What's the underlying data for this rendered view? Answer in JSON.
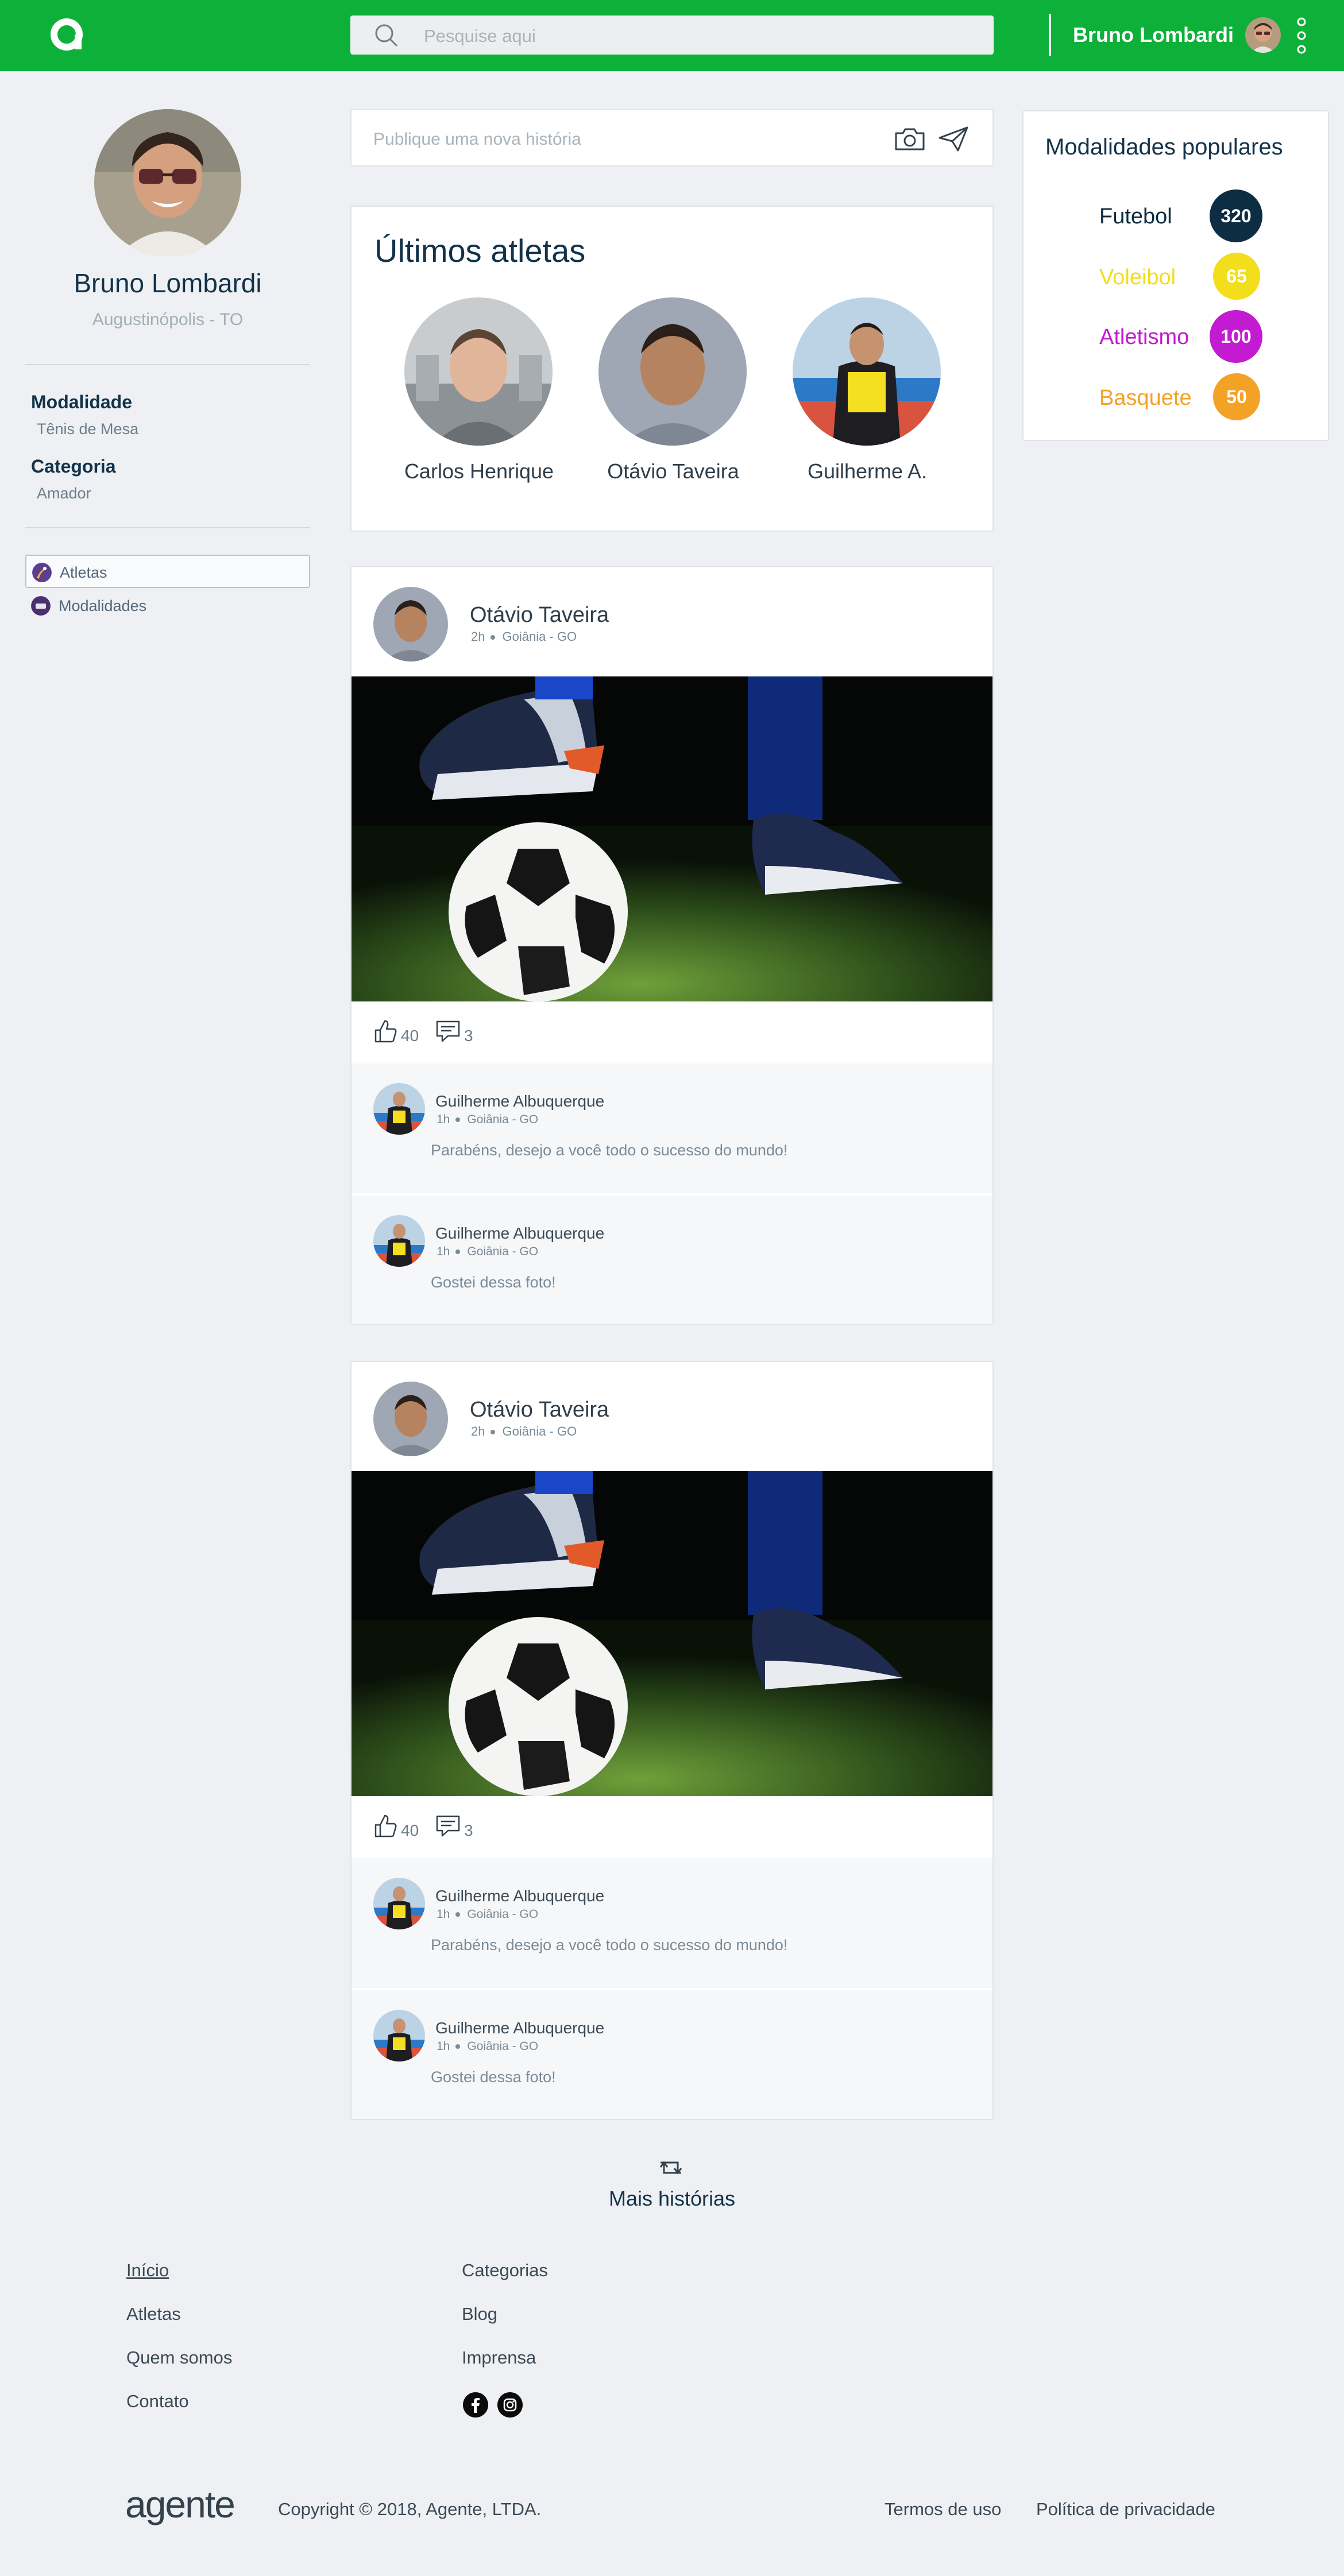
{
  "header": {
    "search_placeholder": "Pesquise aqui",
    "user_name": "Bruno Lombardi"
  },
  "profile": {
    "name": "Bruno Lombardi",
    "city": "Augustinópolis - TO",
    "modality_label": "Modalidade",
    "modality_value": "Tênis de Mesa",
    "category_label": "Categoria",
    "category_value": "Amador"
  },
  "sidebar_nav": [
    {
      "label": "Atletas",
      "active": true
    },
    {
      "label": "Modalidades",
      "active": false
    }
  ],
  "compose": {
    "placeholder": "Publique uma nova história"
  },
  "latest_athletes": {
    "title": "Últimos atletas",
    "items": [
      {
        "name": "Carlos Henrique"
      },
      {
        "name": "Otávio Taveira"
      },
      {
        "name": "Guilherme A."
      }
    ]
  },
  "posts": [
    {
      "author": "Otávio Taveira",
      "time": "2h",
      "location": "Goiânia - GO",
      "likes": "40",
      "comments_count": "3",
      "comments": [
        {
          "author": "Guilherme Albuquerque",
          "time": "1h",
          "location": "Goiânia - GO",
          "text": "Parabéns, desejo a você todo o sucesso do mundo!"
        },
        {
          "author": "Guilherme Albuquerque",
          "time": "1h",
          "location": "Goiânia - GO",
          "text": "Gostei dessa foto!"
        }
      ]
    },
    {
      "author": "Otávio Taveira",
      "time": "2h",
      "location": "Goiânia - GO",
      "likes": "40",
      "comments_count": "3",
      "comments": [
        {
          "author": "Guilherme Albuquerque",
          "time": "1h",
          "location": "Goiânia - GO",
          "text": "Parabéns, desejo a você todo o sucesso do mundo!"
        },
        {
          "author": "Guilherme Albuquerque",
          "time": "1h",
          "location": "Goiânia - GO",
          "text": "Gostei dessa foto!"
        }
      ]
    }
  ],
  "popular": {
    "title": "Modalidades populares",
    "items": [
      {
        "name": "Futebol",
        "count": "320",
        "color": "#0c2d42"
      },
      {
        "name": "Voleibol",
        "count": "65",
        "color": "#f2de1a"
      },
      {
        "name": "Atletismo",
        "count": "100",
        "color": "#c21bd1"
      },
      {
        "name": "Basquete",
        "count": "50",
        "color": "#f4a226"
      }
    ]
  },
  "more_stories": "Mais histórias",
  "footer": {
    "col1": [
      "Início",
      "Atletas",
      "Quem somos",
      "Contato"
    ],
    "col2": [
      "Categorias",
      "Blog",
      "Imprensa"
    ],
    "logo_text": "agente",
    "copyright": "Copyright © 2018, Agente, LTDA.",
    "terms": "Termos de uso",
    "privacy": "Política de privacidade"
  },
  "colors": {
    "brand_green": "#0db13a",
    "navy": "#12334a"
  },
  "icons": [
    "logo-icon",
    "search-icon",
    "more-vertical-icon",
    "camera-icon",
    "send-icon",
    "thumbs-up-icon",
    "comment-icon",
    "refresh-icon",
    "facebook-icon",
    "instagram-icon"
  ]
}
